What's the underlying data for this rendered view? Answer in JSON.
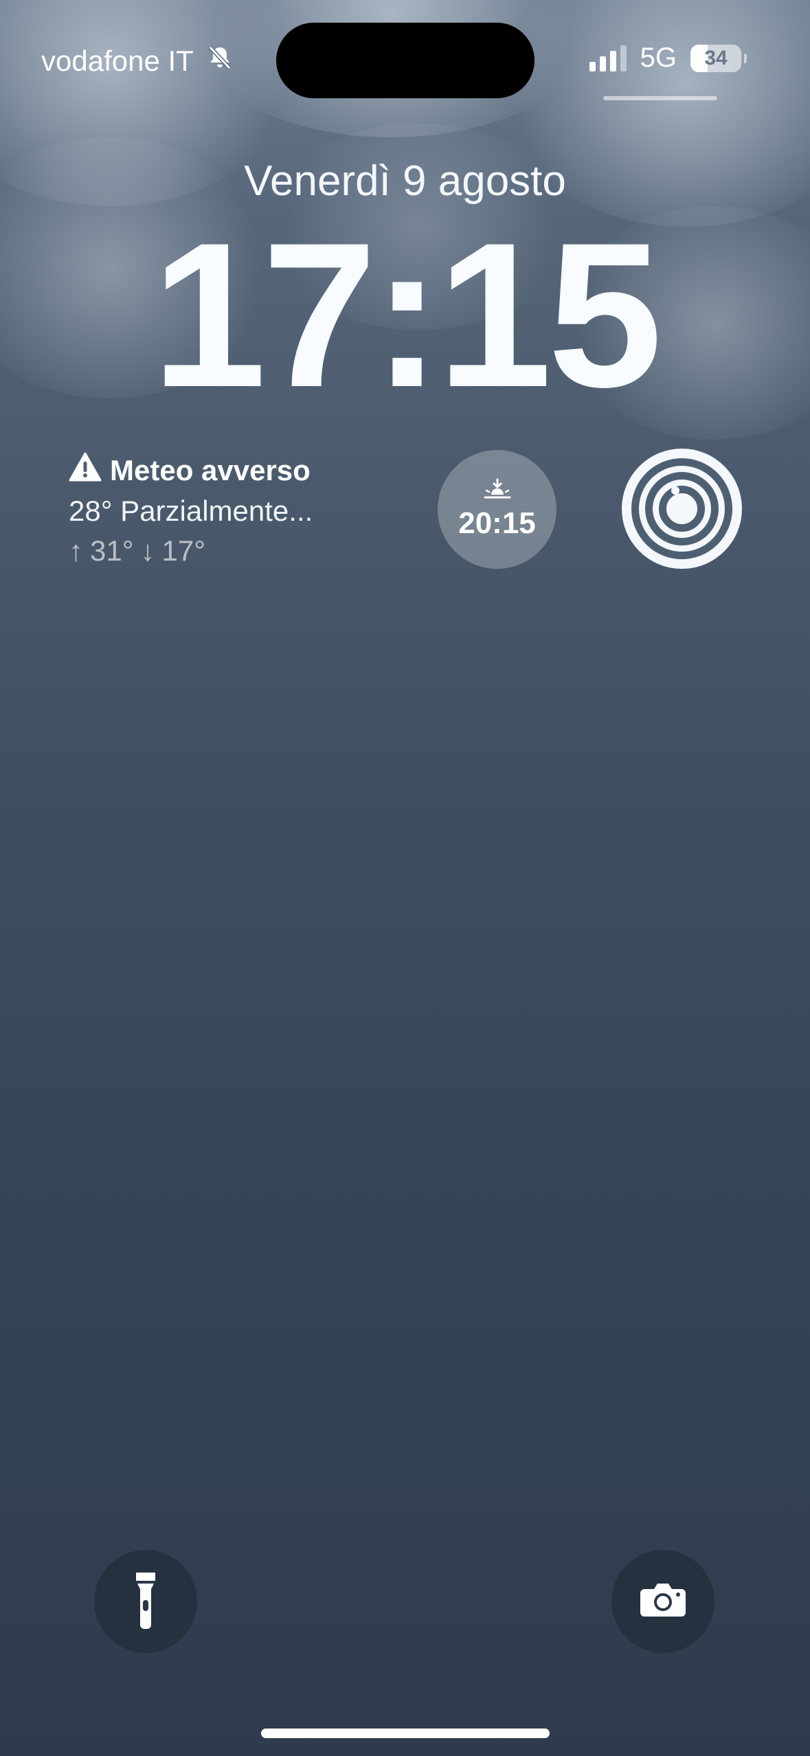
{
  "status_bar": {
    "carrier": "vodafone IT",
    "silent_icon": "bell-slash-icon",
    "signal_bars_active": 3,
    "signal_bars_total": 4,
    "network": "5G",
    "battery_percent": "34"
  },
  "lock_screen": {
    "date": "Venerdì 9 agosto",
    "time": "17:15"
  },
  "widgets": {
    "weather": {
      "alert_icon": "warning-triangle-icon",
      "title": "Meteo avverso",
      "condition": "28° Parzialmente...",
      "high": "31°",
      "low": "17°"
    },
    "sunset": {
      "icon": "sunset-icon",
      "time": "20:15"
    },
    "activity": {
      "icon": "activity-rings-icon"
    }
  },
  "quick_actions": {
    "flashlight": "flashlight-icon",
    "camera": "camera-icon"
  }
}
